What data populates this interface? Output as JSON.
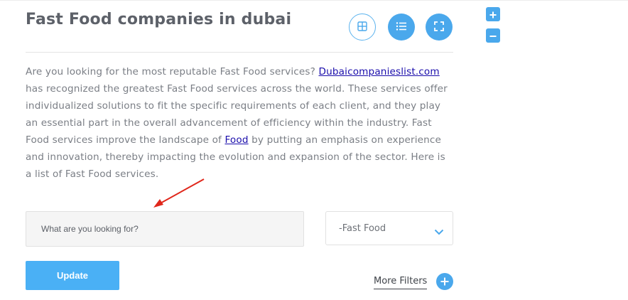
{
  "page": {
    "title": "Fast Food companies in dubai",
    "description": {
      "part1": "Are you looking for the most reputable Fast Food services? ",
      "link1": "Dubaicompanieslist.com",
      "part2": " has recognized the greatest Fast Food services across the world. These services offer individualized solutions to fit the specific requirements of each client, and they play an essential part in the overall advancement of efficiency within the industry. Fast Food services improve the landscape of ",
      "link2": "Food",
      "part3": " by putting an emphasis on experience and innovation, thereby impacting the evolution and expansion of the sector. Here is a list of Fast Food services."
    }
  },
  "view_controls": {
    "grid_icon": "grid-icon",
    "list_icon": "list-icon",
    "fullscreen_icon": "fullscreen-icon"
  },
  "zoom": {
    "plus_icon": "plus-icon",
    "minus_icon": "minus-icon"
  },
  "search": {
    "placeholder": "What are you looking for?",
    "value": ""
  },
  "category_select": {
    "selected": "-Fast Food",
    "chevron_icon": "chevron-down-icon"
  },
  "actions": {
    "update_label": "Update",
    "more_filters_label": "More Filters",
    "more_filters_icon": "plus-circle-icon"
  },
  "colors": {
    "accent": "#4aa8ec",
    "button": "#4ab0f5",
    "title": "#5d6169",
    "body_text": "#7a7e85",
    "link": "#1a0dab",
    "annotation_arrow": "#e0271b"
  }
}
